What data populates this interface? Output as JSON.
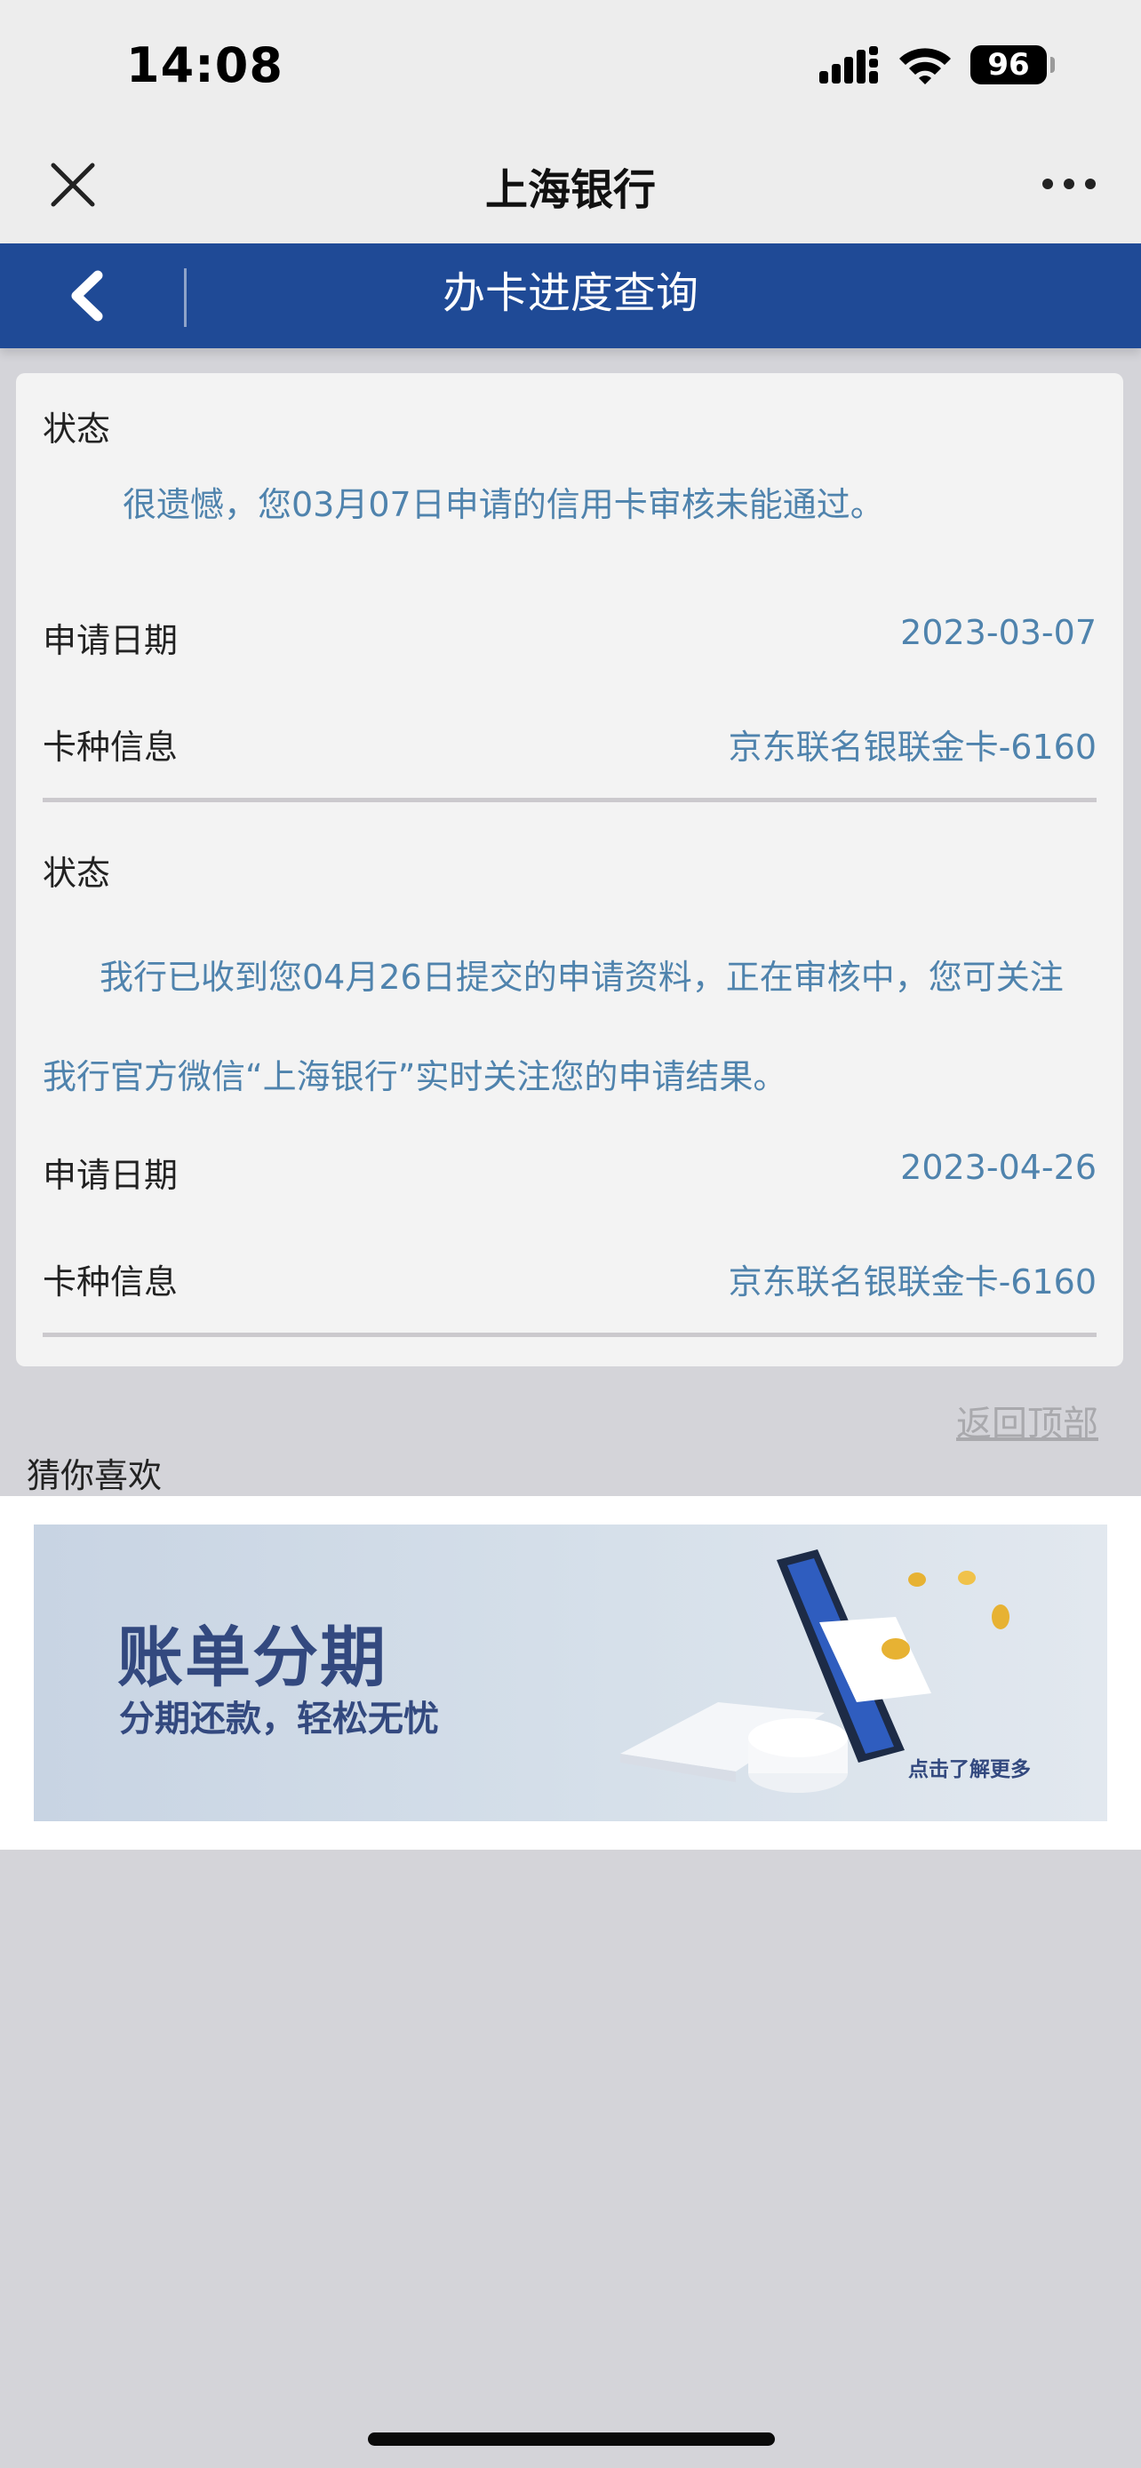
{
  "status_bar": {
    "time": "14:08",
    "battery": "96"
  },
  "nav": {
    "title": "上海银行"
  },
  "header": {
    "title": "办卡进度查询"
  },
  "records": [
    {
      "status_label": "状态",
      "status_text": "很遗憾，您03月07日申请的信用卡审核未能通过。",
      "date_label": "申请日期",
      "date_value": "2023-03-07",
      "card_label": "卡种信息",
      "card_value": "京东联名银联金卡-6160"
    },
    {
      "status_label": "状态",
      "status_text_line1": "我行已收到您04月26日提交的申请资料，正在审核中，您可关注",
      "status_text_line2": "我行官方微信“上海银行”实时关注您的申请结果。",
      "date_label": "申请日期",
      "date_value": "2023-04-26",
      "card_label": "卡种信息",
      "card_value": "京东联名银联金卡-6160"
    }
  ],
  "back_to_top": "返回顶部",
  "recommend": {
    "title": "猜你喜欢",
    "banner": {
      "title": "账单分期",
      "subtitle": "分期还款，轻松无忧",
      "more": "点击了解更多"
    }
  },
  "colors": {
    "header_bg": "#1f4a96",
    "value_text": "#4f83ad",
    "banner_text": "#33497f"
  }
}
